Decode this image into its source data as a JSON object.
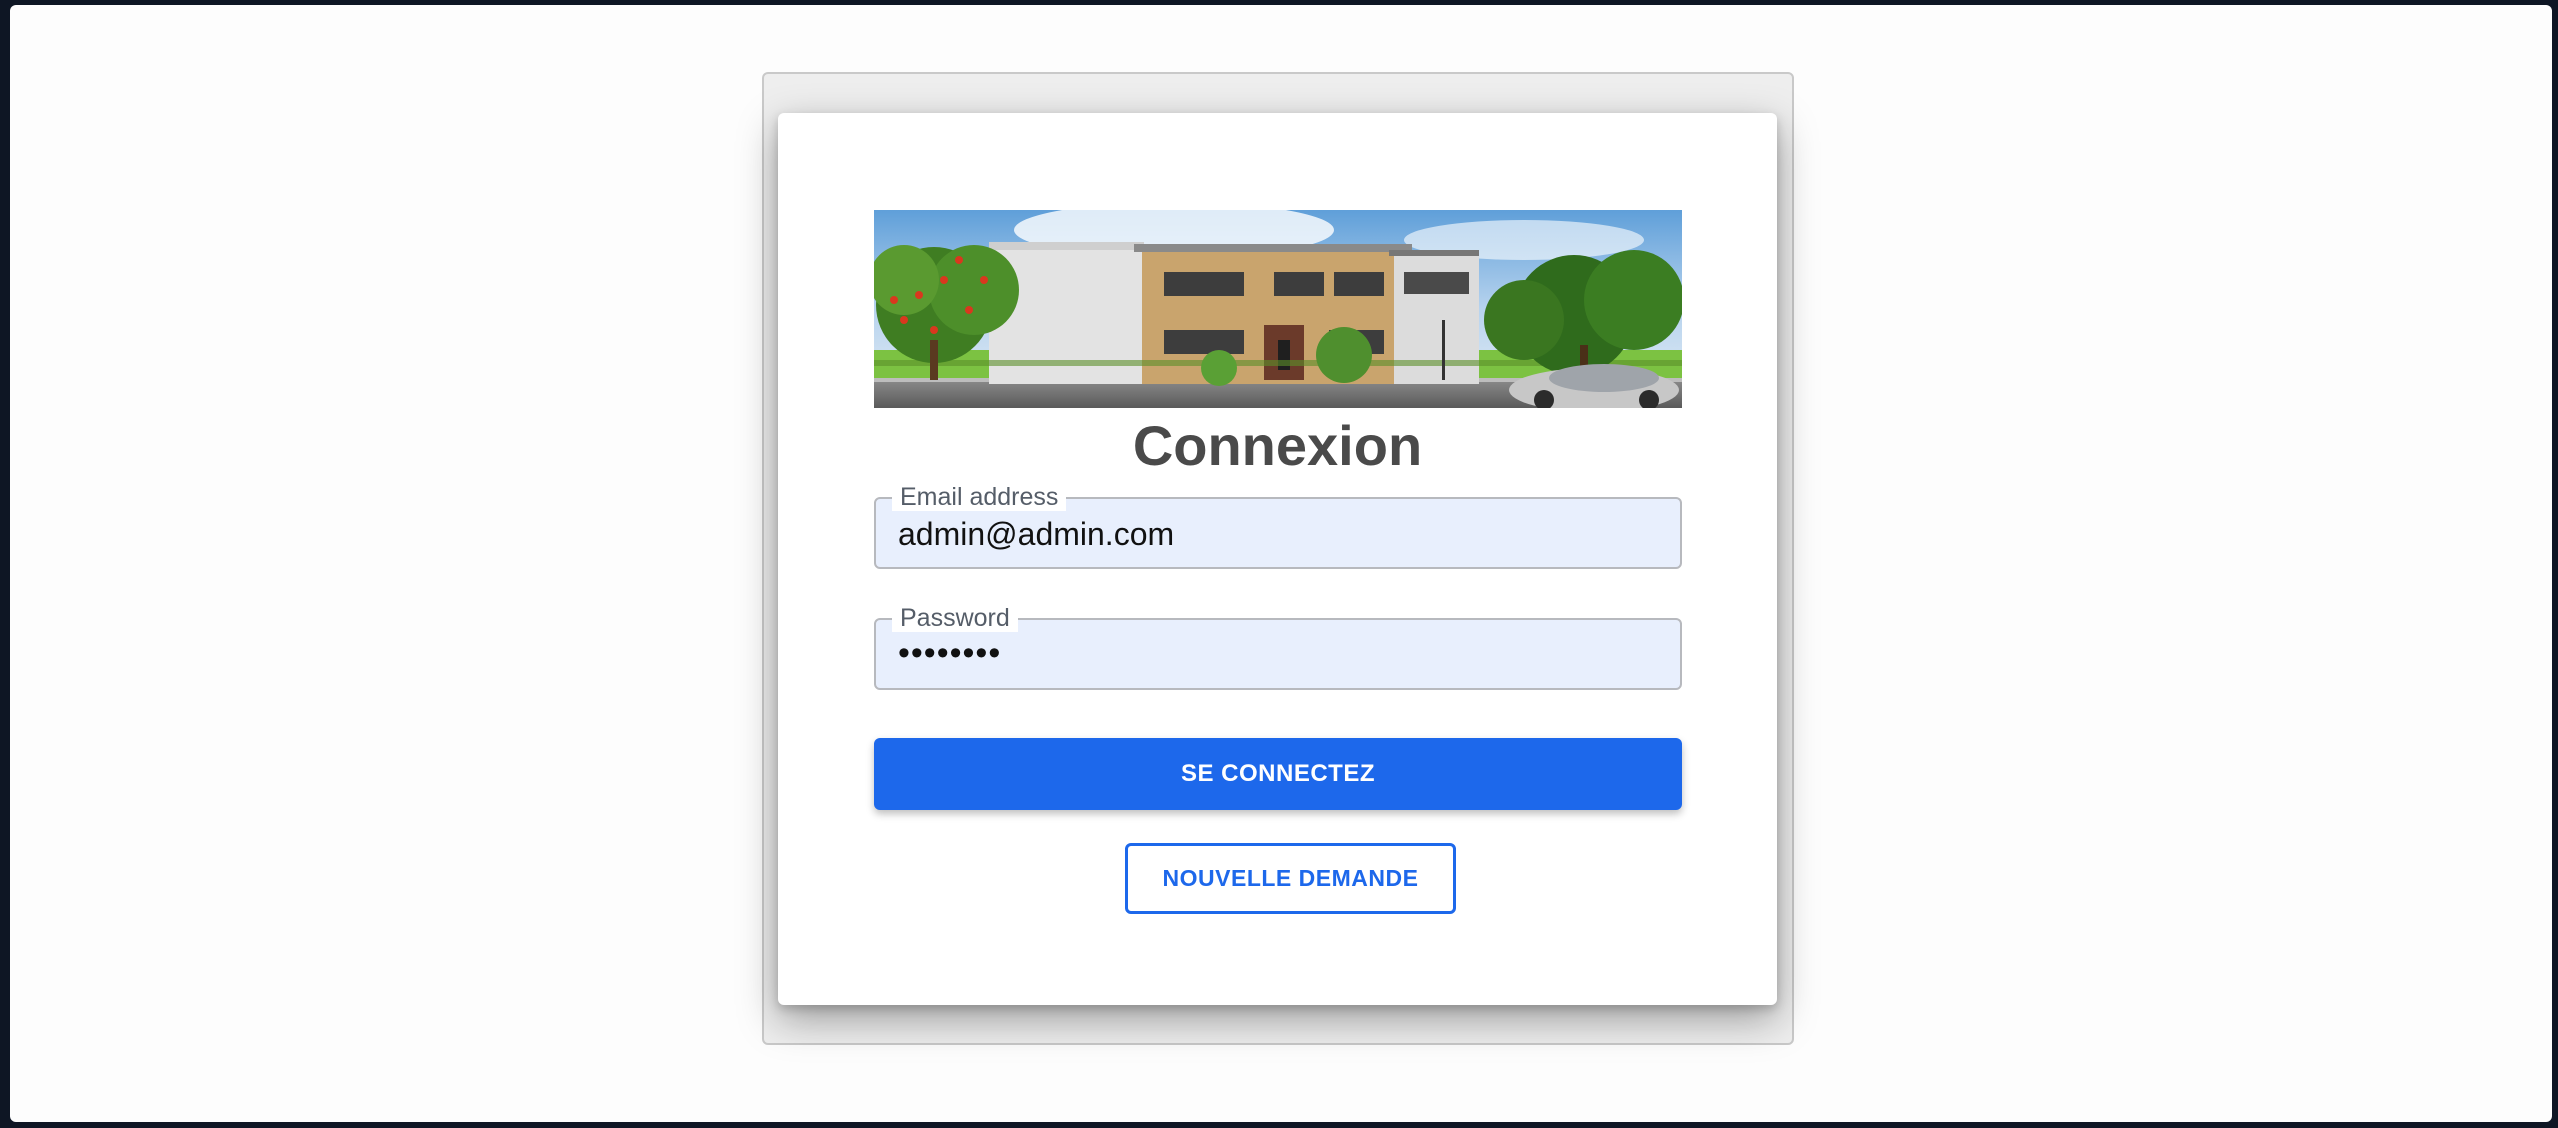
{
  "login": {
    "title": "Connexion",
    "email": {
      "label": "Email address",
      "value": "admin@admin.com"
    },
    "password": {
      "label": "Password",
      "masked_value": "••••••••"
    },
    "submit_label": "SE CONNECTEZ",
    "new_request_label": "NOUVELLE DEMANDE"
  },
  "banner": {
    "icon": "house-illustration"
  },
  "colors": {
    "primary": "#1d68eb",
    "field_background": "#e8effd",
    "title": "#4a4a4a"
  }
}
